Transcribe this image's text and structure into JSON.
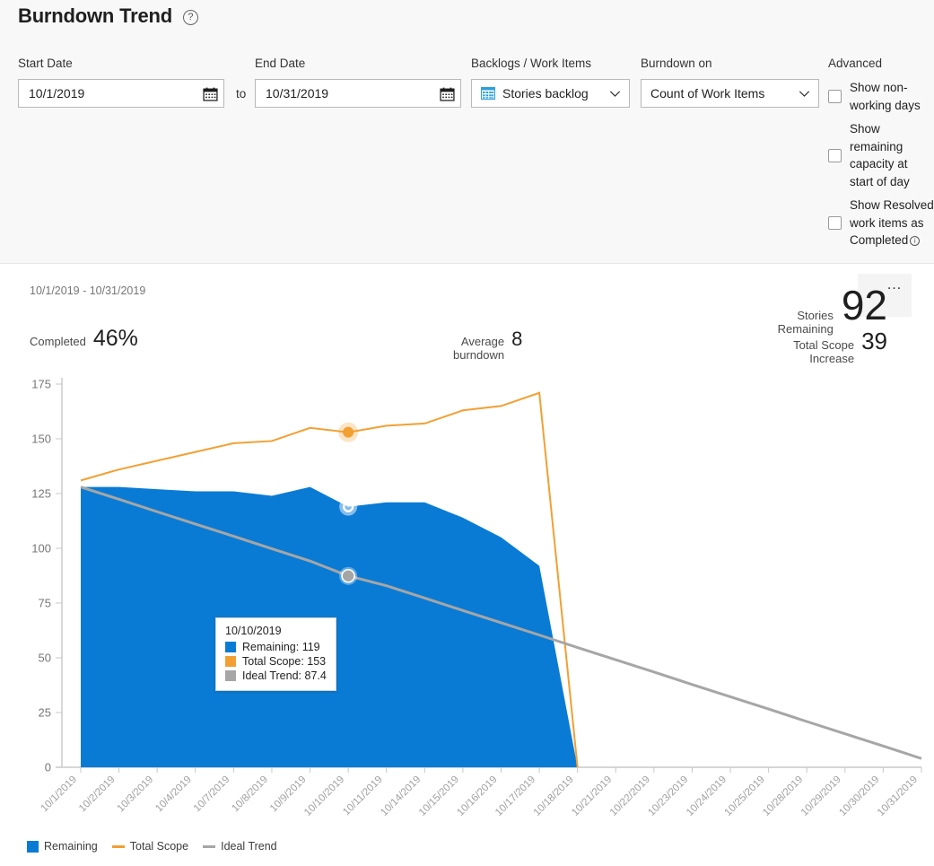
{
  "header": {
    "title": "Burndown Trend",
    "help_icon": "question-circle-icon"
  },
  "filters": {
    "start_date": {
      "label": "Start Date",
      "value": "10/1/2019",
      "placeholder": "Start Date",
      "icon": "calendar-icon"
    },
    "to_label": "to",
    "end_date": {
      "label": "End Date",
      "value": "10/31/2019",
      "placeholder": "End Date",
      "icon": "calendar-icon"
    },
    "backlog": {
      "label": "Backlogs / Work Items",
      "value": "Stories backlog",
      "icon": "backlog-grid-icon",
      "chevron": "chevron-down-icon"
    },
    "burndown_on": {
      "label": "Burndown on",
      "value": "Count of Work Items",
      "chevron": "chevron-down-icon"
    },
    "advanced": {
      "label": "Advanced",
      "options": [
        {
          "label": "Show non-working days",
          "checked": false
        },
        {
          "label": "Show remaining capacity at start of day",
          "checked": false
        },
        {
          "label": "Show Resolved work items as Completed",
          "checked": false,
          "info_icon": "info-circle-icon"
        }
      ]
    }
  },
  "card": {
    "date_range": "10/1/2019 - 10/31/2019",
    "menu_icon": "ellipsis-icon",
    "stats": [
      {
        "name": "stories-remaining",
        "label_line1": "Stories",
        "label_line2": "Remaining",
        "value": "92"
      },
      {
        "name": "total-scope-increase",
        "label_line1": "Total Scope",
        "label_line2": "Increase",
        "value": "39"
      },
      {
        "name": "completed",
        "label_line1": "Completed",
        "label_line2": "",
        "value": "46%"
      },
      {
        "name": "average-burndown",
        "label_line1": "Average",
        "label_line2": "burndown",
        "value": "8"
      }
    ]
  },
  "tooltip": {
    "date": "10/10/2019",
    "rows": [
      {
        "label": "Remaining: 119",
        "color": "#0a7bd4",
        "swatch": "remaining-swatch"
      },
      {
        "label": "Total Scope: 153",
        "color": "#f2a033",
        "swatch": "total-scope-swatch"
      },
      {
        "label": "Ideal Trend: 87.4",
        "color": "#a6a6a6",
        "swatch": "ideal-trend-swatch"
      }
    ]
  },
  "legend": {
    "items": [
      {
        "label": "Remaining",
        "color": "#0a7bd4",
        "marker": "square"
      },
      {
        "label": "Total Scope",
        "color": "#f2a033",
        "marker": "line"
      },
      {
        "label": "Ideal Trend",
        "color": "#a6a6a6",
        "marker": "line"
      }
    ]
  },
  "chart_data": {
    "type": "area",
    "title": "Burndown Trend",
    "xlabel": "",
    "ylabel": "",
    "ylim": [
      0,
      175
    ],
    "yticks": [
      0,
      25,
      50,
      75,
      100,
      125,
      150,
      175
    ],
    "grid": false,
    "legend_position": "bottom-left",
    "categories": [
      "10/1/2019",
      "10/2/2019",
      "10/3/2019",
      "10/4/2019",
      "10/7/2019",
      "10/8/2019",
      "10/9/2019",
      "10/10/2019",
      "10/11/2019",
      "10/14/2019",
      "10/15/2019",
      "10/16/2019",
      "10/17/2019",
      "10/18/2019",
      "10/21/2019",
      "10/22/2019",
      "10/23/2019",
      "10/24/2019",
      "10/25/2019",
      "10/28/2019",
      "10/29/2019",
      "10/30/2019",
      "10/31/2019"
    ],
    "series": [
      {
        "name": "Remaining",
        "type": "area",
        "color": "#0a7bd4",
        "values": [
          128,
          128,
          127,
          126,
          126,
          124,
          128,
          119,
          121,
          121,
          114,
          105,
          92,
          0,
          null,
          null,
          null,
          null,
          null,
          null,
          null,
          null,
          null
        ]
      },
      {
        "name": "Total Scope",
        "type": "line",
        "color": "#f2a033",
        "values": [
          131,
          136,
          140,
          144,
          148,
          149,
          155,
          153,
          156,
          157,
          163,
          165,
          171,
          0,
          null,
          null,
          null,
          null,
          null,
          null,
          null,
          null,
          null
        ]
      },
      {
        "name": "Ideal Trend",
        "type": "line",
        "color": "#a6a6a6",
        "values": [
          128,
          122.4,
          116.7,
          111.1,
          105.5,
          99.8,
          94.2,
          87.4,
          82.9,
          77.3,
          71.6,
          66.0,
          60.4,
          54.7,
          49.1,
          43.5,
          37.8,
          32.2,
          26.6,
          20.9,
          15.3,
          9.7,
          4.0
        ]
      }
    ],
    "highlight_index": 7,
    "highlight_points": [
      {
        "series": "Remaining",
        "value": 119,
        "style": "hollow"
      },
      {
        "series": "Total Scope",
        "value": 153,
        "style": "filled"
      },
      {
        "series": "Ideal Trend",
        "value": 87.4,
        "style": "filled"
      }
    ]
  }
}
